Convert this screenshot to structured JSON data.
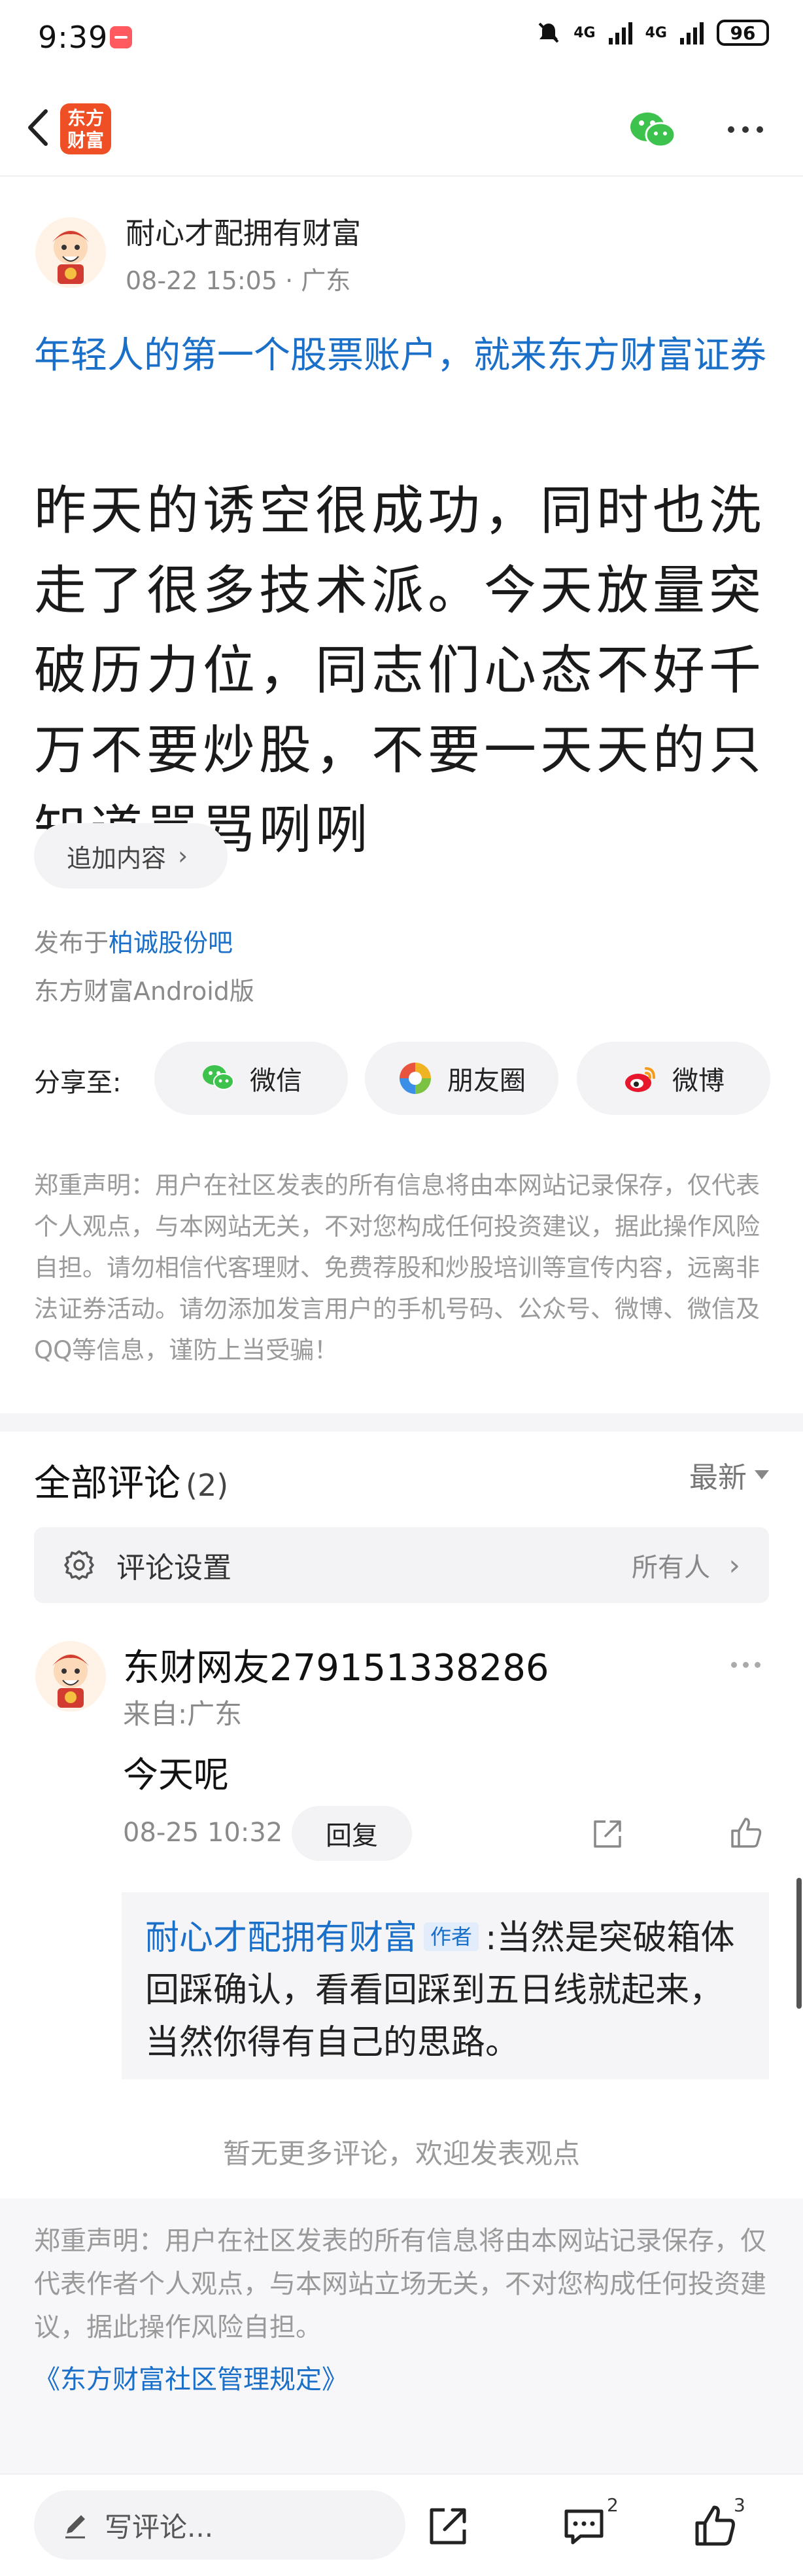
{
  "status_bar": {
    "time": "9:39",
    "network1": "4G",
    "network2": "4G",
    "battery": "96"
  },
  "nav": {
    "logo_text_line1": "东方",
    "logo_text_line2": "财富"
  },
  "post": {
    "author_name": "耐心才配拥有财富",
    "date": "08-22 15:05",
    "location": "广东",
    "promo_text": "年轻人的第一个股票账户，就来东方财富证券",
    "body": "昨天的诱空很成功，同时也洗走了很多技术派。今天放量突破历力位，同志们心态不好千万不要炒股，不要一天天的只知道骂骂咧咧",
    "add_content_label": "追加内容",
    "posted_in_prefix": "发布于",
    "forum_name": "柏诚股份吧",
    "client": "东方财富Android版"
  },
  "share": {
    "label": "分享至:",
    "buttons": [
      {
        "label": "微信",
        "icon": "wechat-icon"
      },
      {
        "label": "朋友圈",
        "icon": "moments-icon"
      },
      {
        "label": "微博",
        "icon": "weibo-icon"
      }
    ]
  },
  "disclaimer_top": "郑重声明：用户在社区发表的所有信息将由本网站记录保存，仅代表个人观点，与本网站无关，不对您构成任何投资建议，据此操作风险自担。请勿相信代客理财、免费荐股和炒股培训等宣传内容，远离非法证券活动。请勿添加发言用户的手机号码、公众号、微博、微信及QQ等信息，谨防上当受骗！",
  "comments": {
    "title": "全部评论",
    "count": "(2)",
    "sort_label": "最新",
    "settings_label": "评论设置",
    "settings_value": "所有人",
    "items": [
      {
        "name": "东财网友279151338286",
        "from": "来自:广东",
        "text": "今天呢",
        "time": "08-25 10:32",
        "reply_label": "回复",
        "reply": {
          "name": "耐心才配拥有财富",
          "tag": "作者",
          "text": ":当然是突破箱体回踩确认，看看回踩到五日线就起来，当然你得有自己的思路。"
        }
      }
    ],
    "no_more": "暂无更多评论，欢迎发表观点"
  },
  "footer": {
    "disclaimer": "郑重声明：用户在社区发表的所有信息将由本网站记录保存，仅代表作者个人观点，与本网站立场无关，不对您构成任何投资建议，据此操作风险自担。",
    "rules_link": "《东方财富社区管理规定》"
  },
  "bottom_bar": {
    "write_placeholder": "写评论...",
    "comment_count": "2",
    "like_count": "3"
  },
  "colors": {
    "link": "#1a6fc9",
    "brand": "#ef4f24",
    "muted": "#9a9a9a"
  }
}
